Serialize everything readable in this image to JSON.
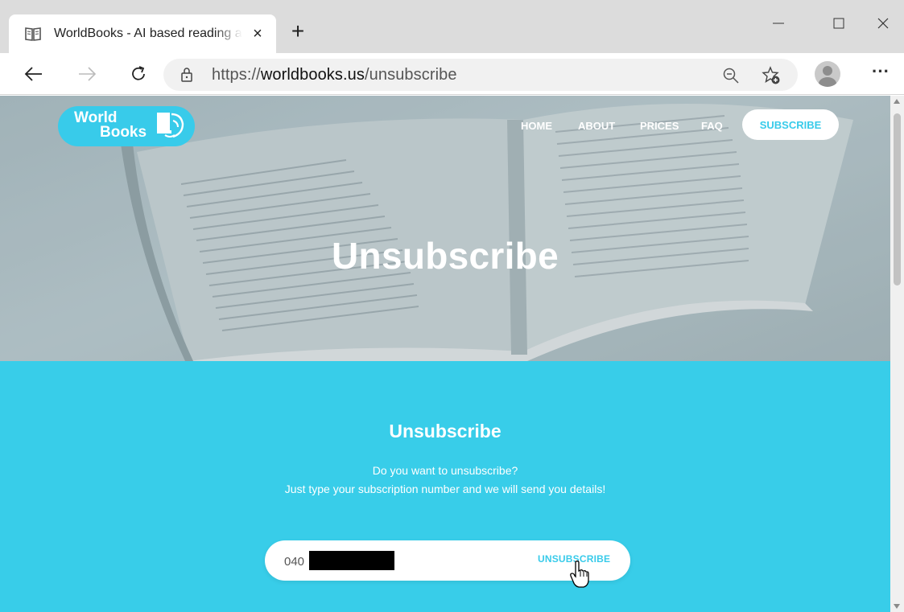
{
  "browser": {
    "tab_title": "WorldBooks - AI based reading a",
    "tab_close": "×",
    "new_tab": "+",
    "url_scheme": "https://",
    "url_host": "worldbooks.us",
    "url_path": "/unsubscribe",
    "menu": "···"
  },
  "site": {
    "logo_line1": "World",
    "logo_line2": "Books",
    "nav": {
      "home": "HOME",
      "about": "ABOUT",
      "prices": "PRICES",
      "faq": "FAQ",
      "subscribe": "SUBSCRIBE"
    },
    "hero_title": "Unsubscribe",
    "accent_color": "#38cde9"
  },
  "unsubscribe": {
    "title": "Unsubscribe",
    "line1": "Do you want to unsubscribe?",
    "line2": "Just type your subscription number and we will send you details!",
    "input_value": "040",
    "button": "UNSUBSCRIBE"
  }
}
